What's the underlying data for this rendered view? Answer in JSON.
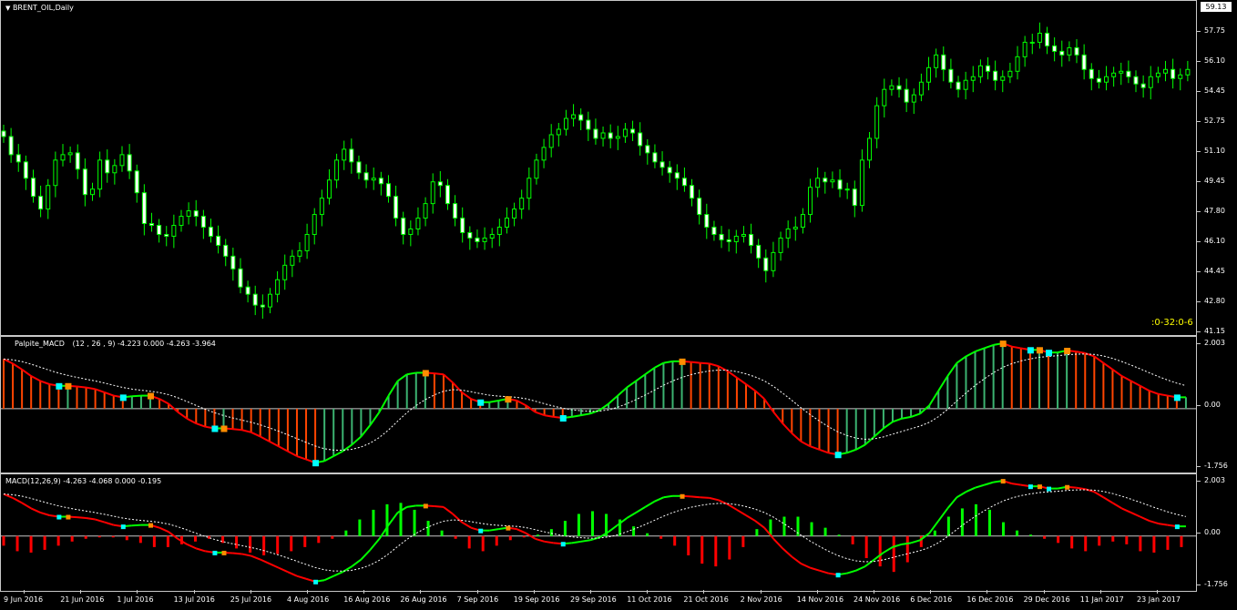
{
  "main": {
    "title": "BRENT_OIL,Daily",
    "timer": ":0-32:0-6",
    "price_box": "59.13",
    "y_labels": [
      "57.75",
      "56.10",
      "54.45",
      "52.75",
      "51.10",
      "49.45",
      "47.80",
      "46.10",
      "44.45",
      "42.80",
      "41.15"
    ]
  },
  "palpite": {
    "title": "Palpite_MACD",
    "params": "(12 , 26 , 9) -4.223 0.000 -4.263 -3.964",
    "y_labels": [
      "2.003",
      "0.00",
      "-1.756"
    ]
  },
  "macd": {
    "title": "MACD(12,26,9) -4.263 -4.068 0.000 -0.195",
    "y_labels": [
      "2.003",
      "0.00",
      "-1.756"
    ]
  },
  "x_labels": [
    "9 Jun 2016",
    "21 Jun 2016",
    "1 Jul 2016",
    "13 Jul 2016",
    "25 Jul 2016",
    "4 Aug 2016",
    "16 Aug 2016",
    "26 Aug 2016",
    "7 Sep 2016",
    "19 Sep 2016",
    "29 Sep 2016",
    "11 Oct 2016",
    "21 Oct 2016",
    "2 Nov 2016",
    "14 Nov 2016",
    "24 Nov 2016",
    "6 Dec 2016",
    "16 Dec 2016",
    "29 Dec 2016",
    "11 Jan 2017",
    "23 Jan 2017"
  ],
  "colors": {
    "bull": "#00ff00",
    "candle_body": "#ffffff",
    "green_hist": "#3cb371",
    "red_hist": "#ff4500",
    "line_green": "#00ff00",
    "line_red": "#ff0000",
    "signal": "#ffffff",
    "marker_orange": "#ff8c00",
    "marker_cyan": "#00ffff",
    "timer": "#ffff00"
  },
  "chart_data": [
    {
      "type": "candlestick",
      "title": "BRENT_OIL,Daily",
      "ylim": [
        41.15,
        59.13
      ],
      "closes": [
        51.9,
        50.9,
        50.5,
        49.6,
        48.6,
        47.9,
        49.2,
        50.6,
        50.9,
        51.0,
        50.1,
        48.7,
        49.0,
        50.6,
        49.9,
        50.3,
        50.9,
        50.0,
        48.8,
        47.1,
        47.0,
        46.5,
        46.4,
        47.0,
        47.5,
        47.8,
        47.5,
        46.9,
        46.4,
        45.9,
        45.3,
        44.6,
        43.6,
        43.2,
        42.6,
        42.5,
        43.2,
        44.0,
        44.8,
        45.3,
        45.6,
        46.5,
        47.6,
        48.5,
        49.5,
        50.6,
        51.2,
        50.5,
        49.9,
        49.5,
        49.6,
        49.3,
        48.6,
        47.4,
        46.5,
        46.8,
        47.4,
        48.2,
        49.4,
        49.2,
        48.2,
        47.4,
        46.6,
        46.3,
        46.1,
        46.3,
        46.5,
        46.9,
        47.4,
        47.9,
        48.5,
        49.6,
        50.6,
        51.3,
        52.0,
        52.3,
        52.9,
        53.1,
        52.8,
        52.3,
        51.8,
        52.1,
        51.8,
        51.9,
        52.3,
        52.1,
        51.4,
        51.0,
        50.5,
        50.2,
        49.9,
        49.6,
        49.2,
        48.5,
        47.6,
        46.9,
        46.5,
        46.2,
        46.1,
        46.4,
        46.5,
        45.9,
        45.2,
        44.5,
        45.5,
        46.3,
        46.8,
        46.9,
        47.6,
        49.1,
        49.6,
        49.4,
        49.5,
        49.0,
        49.0,
        48.1,
        50.6,
        51.8,
        53.6,
        54.5,
        54.7,
        54.5,
        53.8,
        54.2,
        54.9,
        55.7,
        56.4,
        55.6,
        54.9,
        54.5,
        55.0,
        55.2,
        55.8,
        55.5,
        55.0,
        55.2,
        55.5,
        56.3,
        57.1,
        57.1,
        57.6,
        56.9,
        56.6,
        56.4,
        56.8,
        56.4,
        55.6,
        55.1,
        54.9,
        55.2,
        55.4,
        55.5,
        55.2,
        54.8,
        54.6,
        55.2,
        55.4,
        55.6,
        55.1,
        55.3,
        55.6
      ]
    },
    {
      "type": "bar",
      "title": "Palpite_MACD",
      "ylim": [
        -1.756,
        2.003
      ],
      "values": [
        1.52,
        1.38,
        1.2,
        1.0,
        0.85,
        0.75,
        0.7,
        0.7,
        0.68,
        0.65,
        0.6,
        0.5,
        0.4,
        0.35,
        0.38,
        0.4,
        0.4,
        0.3,
        0.15,
        -0.1,
        -0.3,
        -0.45,
        -0.55,
        -0.6,
        -0.6,
        -0.62,
        -0.65,
        -0.72,
        -0.85,
        -1.0,
        -1.15,
        -1.3,
        -1.45,
        -1.55,
        -1.65,
        -1.6,
        -1.45,
        -1.3,
        -1.1,
        -0.85,
        -0.5,
        -0.1,
        0.4,
        0.85,
        1.05,
        1.1,
        1.1,
        1.08,
        1.05,
        0.8,
        0.5,
        0.3,
        0.2,
        0.2,
        0.25,
        0.3,
        0.25,
        0.1,
        -0.1,
        -0.2,
        -0.25,
        -0.28,
        -0.25,
        -0.2,
        -0.15,
        -0.05,
        0.15,
        0.4,
        0.65,
        0.85,
        1.05,
        1.25,
        1.4,
        1.45,
        1.45,
        1.43,
        1.4,
        1.38,
        1.3,
        1.15,
        0.95,
        0.75,
        0.55,
        0.3,
        -0.1,
        -0.45,
        -0.75,
        -1.0,
        -1.15,
        -1.25,
        -1.35,
        -1.4,
        -1.35,
        -1.25,
        -1.1,
        -0.85,
        -0.6,
        -0.4,
        -0.3,
        -0.25,
        -0.15,
        0.1,
        0.55,
        1.0,
        1.4,
        1.6,
        1.75,
        1.85,
        1.95,
        2.0,
        1.9,
        1.85,
        1.8,
        1.8,
        1.72,
        1.72,
        1.78,
        1.75,
        1.7,
        1.6,
        1.4,
        1.2,
        1.0,
        0.85,
        0.7,
        0.55,
        0.45,
        0.4,
        0.35,
        0.35
      ]
    },
    {
      "type": "bar",
      "title": "MACD(12,26,9)",
      "ylim": [
        -1.756,
        2.003
      ],
      "values": [
        -0.35,
        -0.55,
        -0.6,
        -0.5,
        -0.35,
        -0.2,
        -0.1,
        -0.05,
        -0.05,
        -0.15,
        -0.25,
        -0.4,
        -0.4,
        -0.3,
        -0.2,
        -0.1,
        -0.25,
        -0.45,
        -0.6,
        -0.7,
        -0.65,
        -0.55,
        -0.4,
        -0.25,
        -0.1,
        0.2,
        0.6,
        0.95,
        1.15,
        1.2,
        0.95,
        0.55,
        0.2,
        -0.1,
        -0.45,
        -0.55,
        -0.35,
        -0.15,
        -0.05,
        0.05,
        0.25,
        0.55,
        0.8,
        0.9,
        0.8,
        0.6,
        0.35,
        0.1,
        -0.1,
        -0.35,
        -0.7,
        -1.0,
        -1.1,
        -0.85,
        -0.4,
        0.25,
        0.6,
        0.7,
        0.7,
        0.5,
        0.3,
        0.05,
        -0.3,
        -0.8,
        -1.1,
        -1.3,
        -0.95,
        -0.4,
        0.2,
        0.7,
        1.0,
        1.15,
        0.95,
        0.5,
        0.2,
        0.05,
        -0.1,
        -0.25,
        -0.45,
        -0.55,
        -0.35,
        -0.2,
        -0.3,
        -0.55,
        -0.6,
        -0.5,
        -0.4
      ]
    }
  ]
}
